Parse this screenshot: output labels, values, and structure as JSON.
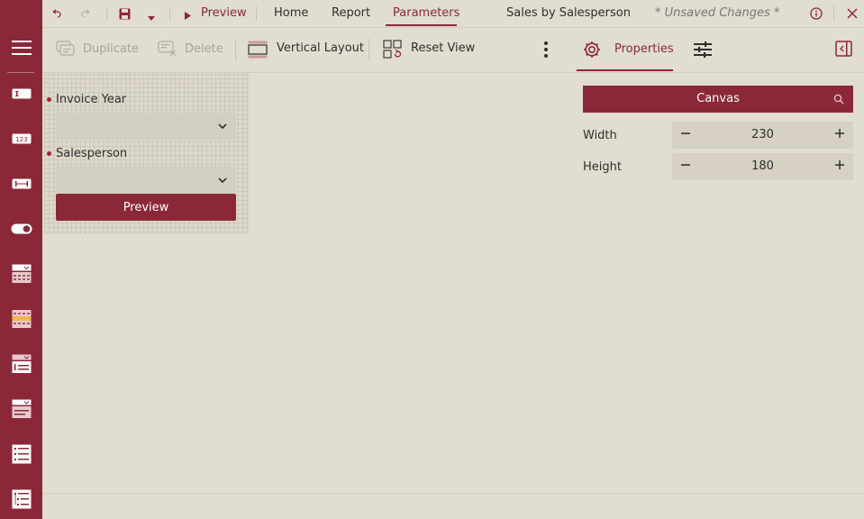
{
  "topbar": {
    "preview_label": "Preview",
    "tabs": [
      {
        "label": "Home"
      },
      {
        "label": "Report"
      },
      {
        "label": "Parameters"
      }
    ],
    "report_title": "Sales by Salesperson",
    "status": "* Unsaved Changes *"
  },
  "toolbar": {
    "duplicate_label": "Duplicate",
    "delete_label": "Delete",
    "layout_label": "Vertical Layout",
    "reset_label": "Reset View",
    "properties_label": "Properties"
  },
  "parameters": [
    {
      "label": "Invoice Year",
      "value": ""
    },
    {
      "label": "Salesperson",
      "value": ""
    }
  ],
  "preview_button_label": "Preview",
  "properties": {
    "canvas_label": "Canvas",
    "width_label": "Width",
    "width_value": "230",
    "height_label": "Height",
    "height_value": "180"
  },
  "colors": {
    "accent": "#8b2838",
    "background": "#e1ddd0",
    "disabled_text": "#a9a396"
  },
  "icons": [
    "undo-icon",
    "redo-icon",
    "save-icon",
    "save-dropdown-icon",
    "play-icon",
    "info-icon",
    "close-icon",
    "hamburger-icon",
    "textbox-icon",
    "numeric-icon",
    "range-icon",
    "toggle-icon",
    "date-dropdown-icon",
    "date-range-icon",
    "list-dropdown-icon",
    "dropdown-icon",
    "list-icon",
    "tree-icon",
    "duplicate-icon",
    "delete-icon",
    "vertical-layout-icon",
    "reset-view-icon",
    "more-vertical-icon",
    "gear-icon",
    "sliders-icon",
    "panel-toggle-icon",
    "search-icon",
    "chevron-down-icon",
    "minus-icon",
    "plus-icon"
  ]
}
